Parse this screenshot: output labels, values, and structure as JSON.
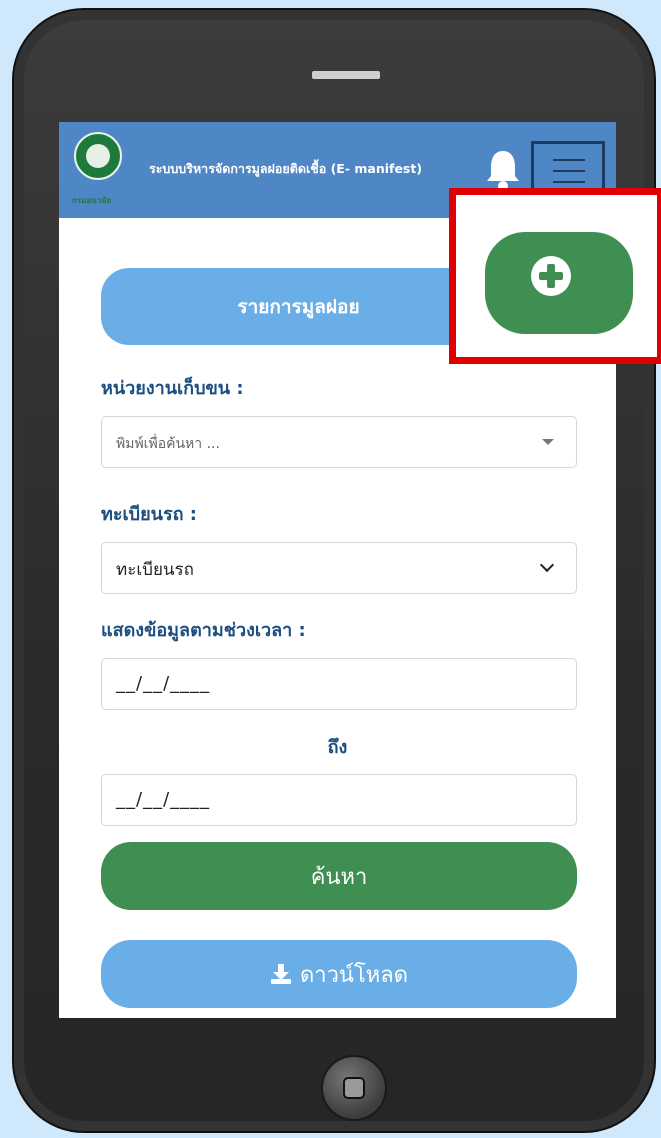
{
  "header": {
    "title": "ระบบบริหารจัดการมูลฝอยติดเชื้อ (E- manifest)",
    "logo_caption": "กรมอนามัย"
  },
  "section_button": {
    "label": "รายการมูลฝอย"
  },
  "form": {
    "collector_label": "หน่วยงานเก็บขน :",
    "collector_placeholder": "พิมพ์เพื่อค้นหา ...",
    "plate_label": "ทะเบียนรถ :",
    "plate_value": "ทะเบียนรถ",
    "period_label": "แสดงข้อมูลตามช่วงเวลา :",
    "date_from": "__/__/____",
    "to_label": "ถึง",
    "date_to": "__/__/____",
    "search_label": "ค้นหา",
    "download_label": "ดาวน์โหลด"
  },
  "icons": {
    "bell": "bell-icon",
    "menu": "hamburger-menu-icon",
    "add": "plus-circle-icon",
    "download": "download-icon"
  },
  "colors": {
    "navbar": "#4e86c6",
    "primary_light": "#6aaee7",
    "success": "#3f8e52",
    "highlight": "#e00000"
  }
}
